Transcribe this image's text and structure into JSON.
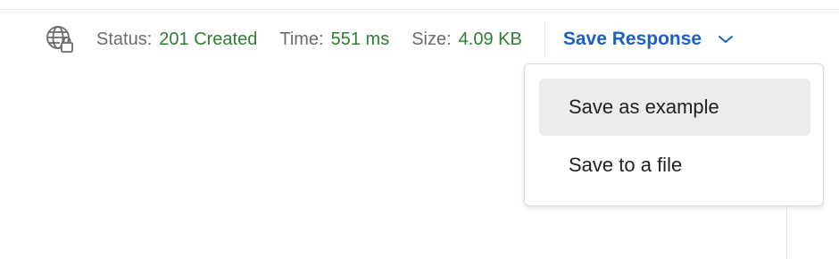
{
  "status_bar": {
    "status_label": "Status:",
    "status_value": "201 Created",
    "time_label": "Time:",
    "time_value": "551 ms",
    "size_label": "Size:",
    "size_value": "4.09 KB",
    "network_icon": "globe-lock-icon"
  },
  "save_response": {
    "label": "Save Response",
    "chevron_icon": "chevron-down-icon",
    "menu": [
      {
        "label": "Save as example",
        "highlighted": true
      },
      {
        "label": "Save to a file",
        "highlighted": false
      }
    ]
  },
  "colors": {
    "success": "#2f7d32",
    "accent": "#1f5fc4",
    "muted_text": "#6b6b6b",
    "menu_highlight": "#ececec"
  }
}
